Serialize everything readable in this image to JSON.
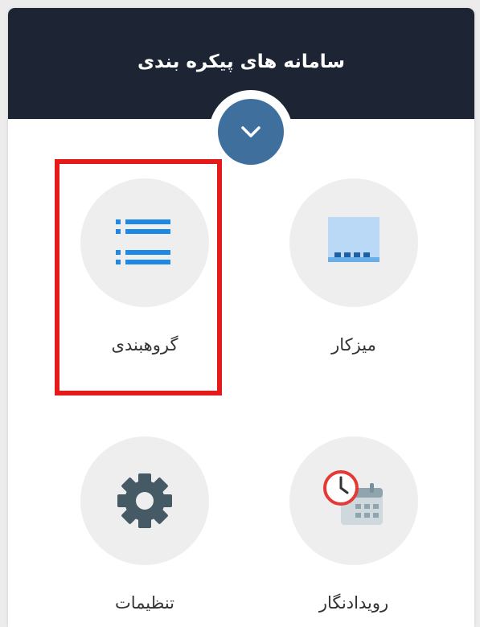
{
  "header": {
    "title": "سامانه های پیکره بندی",
    "background": "#1d2534"
  },
  "toggle": {
    "icon": "chevron-down-icon",
    "color": "#3f6f9d"
  },
  "tiles": [
    {
      "label": "میزکار",
      "icon": "desk-icon"
    },
    {
      "label": "گروهبندی",
      "icon": "list-icon"
    },
    {
      "label": "رویدادنگار",
      "icon": "calendar-clock-icon"
    },
    {
      "label": "تنظیمات",
      "icon": "gear-icon"
    }
  ],
  "highlight": {
    "target": "گروهبندی",
    "color": "#e51b1b"
  }
}
